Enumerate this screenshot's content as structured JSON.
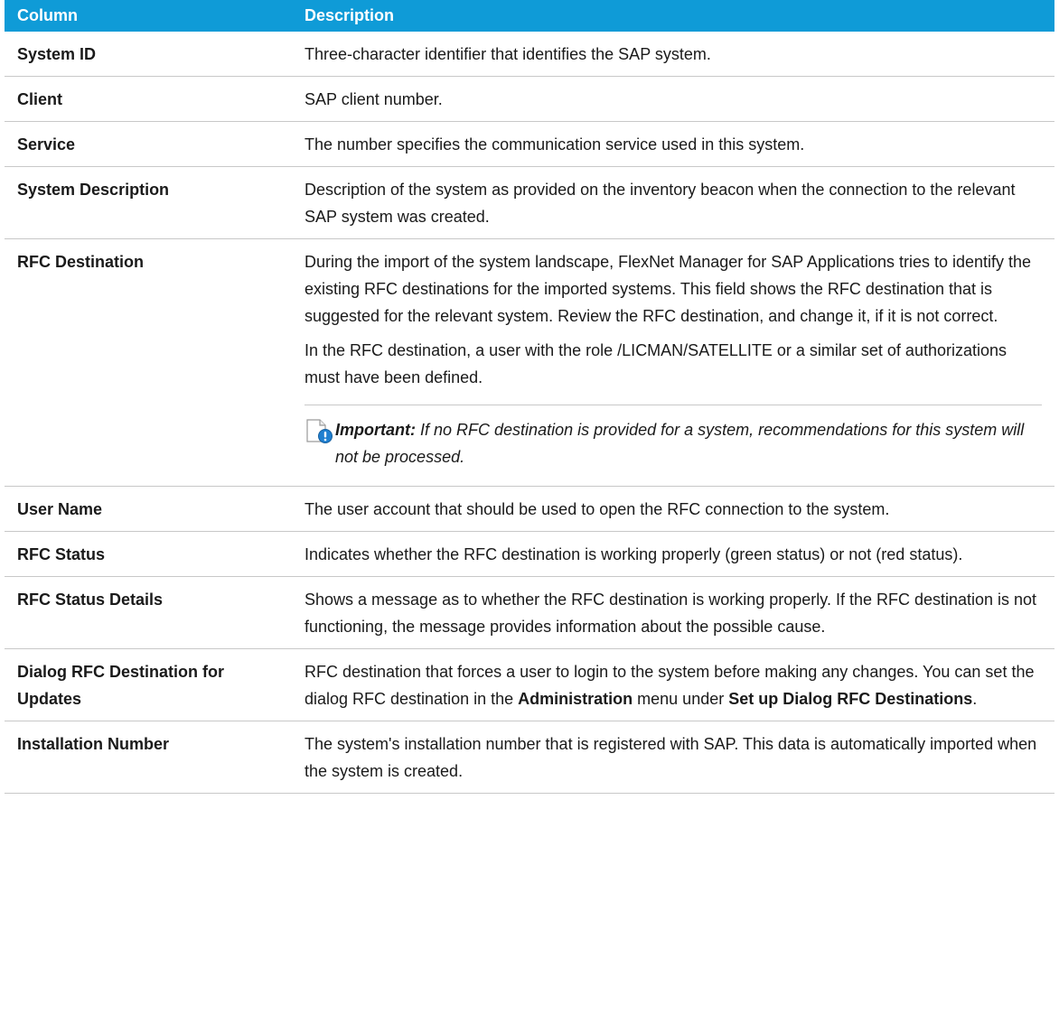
{
  "header": {
    "col1": "Column",
    "col2": "Description"
  },
  "rows": [
    {
      "name": "System ID",
      "desc": "Three-character identifier that identifies the SAP system."
    },
    {
      "name": "Client",
      "desc": "SAP client number."
    },
    {
      "name": "Service",
      "desc": "The number specifies the communication service used in this system."
    },
    {
      "name": "System Description",
      "desc": "Description of the system as provided on the inventory beacon when the connection to the relevant SAP system was created."
    },
    {
      "name": "RFC Destination",
      "p1": "During the import of the system landscape, FlexNet Manager for SAP Applications tries to identify the existing RFC destinations for the imported systems. This field shows the RFC destination that is suggested for the relevant system. Review the RFC destination, and change it, if it is not correct.",
      "p2": "In the RFC destination, a user with the role /LICMAN/SATELLITE or a similar set of authorizations must have been defined.",
      "note_label": "Important:",
      "note_text": "If no RFC destination is provided for a system, recommendations for this system will not be processed.",
      "note_icon": "important-note-icon"
    },
    {
      "name": "User Name",
      "desc": "The user account that should be used to open the RFC connection to the system."
    },
    {
      "name": "RFC Status",
      "desc": "Indicates whether the RFC destination is working properly (green status) or not (red status)."
    },
    {
      "name": "RFC Status Details",
      "desc": "Shows a message as to whether the RFC destination is working properly. If the RFC destination is not functioning, the message provides information about the possible cause."
    },
    {
      "name": "Dialog RFC Destination for Updates",
      "d1": "RFC destination that forces a user to login to the system before making any changes. You can set the dialog RFC destination in the ",
      "d2": "Administration",
      "d3": " menu under ",
      "d4": "Set up Dialog RFC Destinations",
      "d5": "."
    },
    {
      "name": "Installation Number",
      "desc": "The system's installation number that is registered with SAP. This data is automatically imported when the system is created."
    }
  ],
  "colors": {
    "header_bg": "#0f9bd7",
    "rule": "#c8c8c8"
  }
}
